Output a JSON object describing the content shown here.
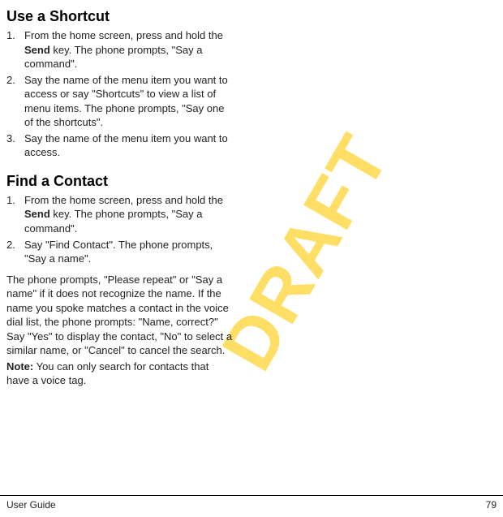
{
  "watermark": "DRAFT",
  "section1": {
    "heading": "Use a Shortcut",
    "steps": [
      {
        "pre": "From the home screen, press and hold the ",
        "bold": "Send",
        "post": " key. The phone prompts, \"Say a command\"."
      },
      {
        "text": "Say the name of the menu item you want to access or say \"Shortcuts\" to view a list of menu items. The phone prompts, \"Say one of the shortcuts\"."
      },
      {
        "text": "Say the name of the menu item you want to access."
      }
    ]
  },
  "section2": {
    "heading": "Find a Contact",
    "steps": [
      {
        "pre": "From the home screen, press and hold the ",
        "bold": "Send",
        "post": " key. The phone prompts, \"Say a command\"."
      },
      {
        "text": "Say \"Find Contact\". The phone prompts, \"Say a name\"."
      }
    ],
    "para": "The phone prompts, \"Please repeat\" or \"Say a name\" if it does not recognize the name. If the name you spoke matches a contact in the voice dial list, the phone prompts: \"Name, correct?\" Say \"Yes\" to display the contact, \"No\" to select a similar name, or \"Cancel\" to cancel the search.",
    "note_label": "Note:",
    "note_text": " You can only search for contacts that have a voice tag."
  },
  "footer": {
    "left": "User Guide",
    "right": "79"
  }
}
